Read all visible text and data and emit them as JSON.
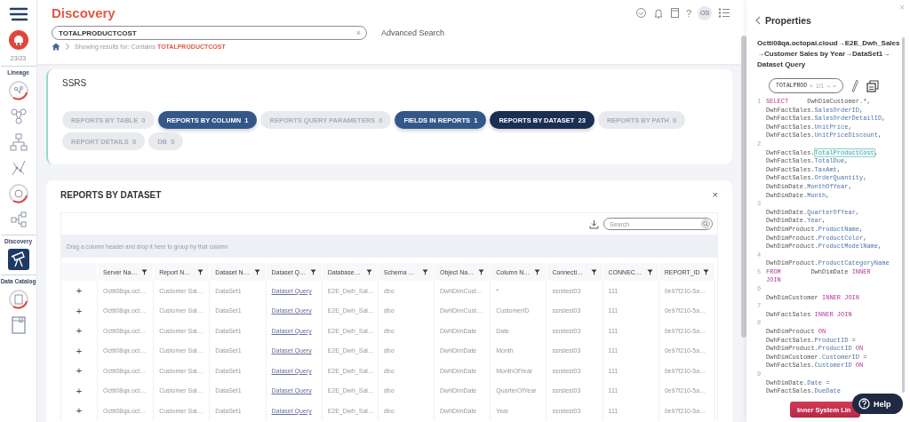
{
  "sidebar": {
    "items": [
      {
        "kind": "icon",
        "selected": false
      },
      {
        "kind": "icon",
        "selected": false
      },
      {
        "kind": "counter",
        "text": "23/23"
      },
      {
        "kind": "label",
        "text": "Lineage"
      },
      {
        "kind": "icon",
        "selected": false
      },
      {
        "kind": "icon",
        "selected": false
      },
      {
        "kind": "icon",
        "selected": false
      },
      {
        "kind": "icon",
        "selected": false
      },
      {
        "kind": "icon",
        "selected": false
      },
      {
        "kind": "icon",
        "selected": false
      },
      {
        "kind": "label",
        "text": "Discovery"
      },
      {
        "kind": "icon",
        "selected": true
      },
      {
        "kind": "label",
        "text": "Data Catalog"
      },
      {
        "kind": "icon",
        "selected": false
      },
      {
        "kind": "icon",
        "selected": false
      }
    ]
  },
  "header": {
    "title": "Discovery",
    "help": "?",
    "avatar": "OS",
    "search": {
      "value": "TOTALPRODUCTCOST",
      "clear": "×"
    },
    "advanced_search": "Advanced Search",
    "breadcrumb": "Showing results for: Contains **TOTALPRODUCTCOST**"
  },
  "ssrs": {
    "title": "SSRS",
    "tabs": [
      {
        "label": "REPORTS BY TABLE  0",
        "selected": false,
        "disabled": true
      },
      {
        "label": "REPORTS BY COLUMN  1",
        "selected": false,
        "disabled": false
      },
      {
        "label": "REPORTS QUERY PARAMETERS  0",
        "selected": false,
        "disabled": true
      },
      {
        "label": "FIELDS IN REPORTS  1",
        "selected": false,
        "disabled": false
      },
      {
        "label": "REPORTS BY DATASET  23",
        "selected": true,
        "disabled": false
      },
      {
        "label": "REPORTS BY PATH  0",
        "selected": false,
        "disabled": true
      },
      {
        "label": "REPORT DETAILS  0",
        "selected": false,
        "disabled": true
      },
      {
        "label": "DB  0",
        "selected": false,
        "disabled": true
      }
    ]
  },
  "reports": {
    "title": "REPORTS BY DATASET",
    "close": "×",
    "search": {
      "placeholder": "Search"
    },
    "group_hint": "Drag a column header and drop it here to group by that column",
    "columns": [
      {
        "label": "Server Na…",
        "kind": "text"
      },
      {
        "label": "Report N…",
        "kind": "text"
      },
      {
        "label": "Dataset N…",
        "kind": "text"
      },
      {
        "label": "Dataset Q…",
        "kind": "link"
      },
      {
        "label": "Database…",
        "kind": "text"
      },
      {
        "label": "Schema …",
        "kind": "text"
      },
      {
        "label": "Object Na…",
        "kind": "text"
      },
      {
        "label": "Column N…",
        "kind": "text"
      },
      {
        "label": "Connecti…",
        "kind": "text"
      },
      {
        "label": "CONNEC…",
        "kind": "text"
      },
      {
        "label": "REPORT_ID",
        "kind": "text"
      }
    ],
    "rows": [
      {
        "expand": "+",
        "cells": [
          "Octti08qa.oct…",
          "Customer Sal…",
          "DataSet1",
          "Dataset Query",
          "E2E_Dwh_Sal…",
          "dbo",
          "DwhDimCust…",
          "*",
          "ssrstest03",
          "111",
          "0e97f210-5a…"
        ]
      },
      {
        "expand": "+",
        "cells": [
          "Octti08qa.oct…",
          "Customer Sal…",
          "DataSet1",
          "Dataset Query",
          "E2E_Dwh_Sal…",
          "dbo",
          "DwhDimCust…",
          "CustomerID",
          "ssrstest03",
          "111",
          "0e97f210-5a…"
        ]
      },
      {
        "expand": "+",
        "cells": [
          "Octti08qa.oct…",
          "Customer Sal…",
          "DataSet1",
          "Dataset Query",
          "E2E_Dwh_Sal…",
          "dbo",
          "DwhDimDate",
          "Date",
          "ssrstest03",
          "111",
          "0e97f210-5a…"
        ]
      },
      {
        "expand": "+",
        "cells": [
          "Octti08qa.oct…",
          "Customer Sal…",
          "DataSet1",
          "Dataset Query",
          "E2E_Dwh_Sal…",
          "dbo",
          "DwhDimDate",
          "Month",
          "ssrstest03",
          "111",
          "0e97f210-5a…"
        ]
      },
      {
        "expand": "+",
        "cells": [
          "Octti08qa.oct…",
          "Customer Sal…",
          "DataSet1",
          "Dataset Query",
          "E2E_Dwh_Sal…",
          "dbo",
          "DwhDimDate",
          "MonthOfYear",
          "ssrstest03",
          "111",
          "0e97f210-5a…"
        ]
      },
      {
        "expand": "+",
        "cells": [
          "Octti08qa.oct…",
          "Customer Sal…",
          "DataSet1",
          "Dataset Query",
          "E2E_Dwh_Sal…",
          "dbo",
          "DwhDimDate",
          "QuarterOfYear",
          "ssrstest03",
          "111",
          "0e97f210-5a…"
        ]
      },
      {
        "expand": "+",
        "cells": [
          "Octti08qa.oct…",
          "Customer Sal…",
          "DataSet1",
          "Dataset Query",
          "E2E_Dwh_Sal…",
          "dbo",
          "DwhDimDate",
          "Year",
          "ssrstest03",
          "111",
          "0e97f210-5a…"
        ]
      }
    ]
  },
  "properties": {
    "title": "Properties",
    "close": "×",
    "path": "Octti08qa.octopai.cloud→E2E_Dwh_Sales →Customer Sales by Year→DataSet1→ Dataset Query",
    "find": {
      "value": "TOTALPROD",
      "clear": "×",
      "count": "1/1"
    },
    "code": [
      {
        "number": "1",
        "leading_blank": false,
        "lines": [
          {
            "segments": [
              {
                "text": "SELECT",
                "kind": "keyword"
              },
              {
                "text": "     DwhDimCustomer.*,",
                "kind": "plain"
              }
            ]
          },
          {
            "segments": [
              {
                "text": "DwhFactSales.",
                "kind": "plain"
              },
              {
                "text": "SalesOrderID",
                "kind": "field"
              },
              {
                "text": ",",
                "kind": "plain"
              }
            ]
          },
          {
            "segments": [
              {
                "text": "DwhFactSales.",
                "kind": "plain"
              },
              {
                "text": "SalesOrderDetailID",
                "kind": "field"
              },
              {
                "text": ",",
                "kind": "plain"
              }
            ]
          },
          {
            "segments": [
              {
                "text": "DwhFactSales.",
                "kind": "plain"
              },
              {
                "text": "UnitPrice",
                "kind": "field"
              },
              {
                "text": ",",
                "kind": "plain"
              }
            ]
          },
          {
            "segments": [
              {
                "text": "DwhFactSales.",
                "kind": "plain"
              },
              {
                "text": "UnitPriceDiscount",
                "kind": "field"
              },
              {
                "text": ",",
                "kind": "plain"
              }
            ]
          }
        ]
      },
      {
        "number": "2",
        "leading_blank": true,
        "lines": [
          {
            "segments": [
              {
                "text": "DwhFactSales.",
                "kind": "plain"
              },
              {
                "text": "TotalProductCost",
                "kind": "match"
              },
              {
                "text": ",",
                "kind": "plain"
              }
            ]
          },
          {
            "segments": [
              {
                "text": "DwhFactSales.",
                "kind": "plain"
              },
              {
                "text": "TotalDue",
                "kind": "field"
              },
              {
                "text": ",",
                "kind": "plain"
              }
            ]
          },
          {
            "segments": [
              {
                "text": "DwhFactSales.",
                "kind": "plain"
              },
              {
                "text": "TaxAmt",
                "kind": "field"
              },
              {
                "text": ",",
                "kind": "plain"
              }
            ]
          },
          {
            "segments": [
              {
                "text": "DwhFactSales.",
                "kind": "plain"
              },
              {
                "text": "OrderQuantity",
                "kind": "field"
              },
              {
                "text": ",",
                "kind": "plain"
              }
            ]
          },
          {
            "segments": [
              {
                "text": "DwhDimDate.",
                "kind": "plain"
              },
              {
                "text": "MonthOfYear",
                "kind": "field"
              },
              {
                "text": ",",
                "kind": "plain"
              }
            ]
          },
          {
            "segments": [
              {
                "text": "DwhDimDate.",
                "kind": "plain"
              },
              {
                "text": "Month",
                "kind": "field"
              },
              {
                "text": ",",
                "kind": "plain"
              }
            ]
          }
        ]
      },
      {
        "number": "3",
        "leading_blank": true,
        "lines": [
          {
            "segments": [
              {
                "text": "DwhDimDate.",
                "kind": "plain"
              },
              {
                "text": "QuarterOfYear",
                "kind": "field"
              },
              {
                "text": ",",
                "kind": "plain"
              }
            ]
          },
          {
            "segments": [
              {
                "text": "DwhDimDate.",
                "kind": "plain"
              },
              {
                "text": "Year",
                "kind": "field"
              },
              {
                "text": ",",
                "kind": "plain"
              }
            ]
          },
          {
            "segments": [
              {
                "text": "DwhDimProduct.",
                "kind": "plain"
              },
              {
                "text": "ProductName",
                "kind": "field"
              },
              {
                "text": ",",
                "kind": "plain"
              }
            ]
          },
          {
            "segments": [
              {
                "text": "DwhDimProduct.",
                "kind": "plain"
              },
              {
                "text": "ProductColor",
                "kind": "field"
              },
              {
                "text": ",",
                "kind": "plain"
              }
            ]
          },
          {
            "segments": [
              {
                "text": "DwhDimProduct.",
                "kind": "plain"
              },
              {
                "text": "ProductModelName",
                "kind": "field"
              },
              {
                "text": ",",
                "kind": "plain"
              }
            ]
          }
        ]
      },
      {
        "number": "4",
        "leading_blank": true,
        "lines": [
          {
            "segments": [
              {
                "text": "DwhDimProduct.",
                "kind": "plain"
              },
              {
                "text": "ProductCategoryName",
                "kind": "field"
              }
            ]
          }
        ]
      },
      {
        "number": "5",
        "leading_blank": false,
        "lines": [
          {
            "segments": [
              {
                "text": "FROM",
                "kind": "keyword"
              },
              {
                "text": "        DwhDimDate ",
                "kind": "plain"
              },
              {
                "text": "INNER",
                "kind": "keyword"
              }
            ]
          },
          {
            "segments": [
              {
                "text": "JOIN",
                "kind": "keyword"
              }
            ]
          }
        ]
      },
      {
        "number": "6",
        "leading_blank": true,
        "lines": [
          {
            "segments": [
              {
                "text": "DwhDimCustomer ",
                "kind": "plain"
              },
              {
                "text": "INNER JOIN",
                "kind": "keyword"
              }
            ]
          }
        ]
      },
      {
        "number": "7",
        "leading_blank": true,
        "lines": [
          {
            "segments": [
              {
                "text": "DwhFactSales ",
                "kind": "plain"
              },
              {
                "text": "INNER JOIN",
                "kind": "keyword"
              }
            ]
          }
        ]
      },
      {
        "number": "8",
        "leading_blank": true,
        "lines": [
          {
            "segments": [
              {
                "text": "DwhDimProduct ",
                "kind": "plain"
              },
              {
                "text": "ON",
                "kind": "keyword"
              }
            ]
          },
          {
            "segments": [
              {
                "text": "DwhFactSales.",
                "kind": "plain"
              },
              {
                "text": "ProductID",
                "kind": "field"
              },
              {
                "text": " =",
                "kind": "plain"
              }
            ]
          },
          {
            "segments": [
              {
                "text": "DwhDimProduct.",
                "kind": "plain"
              },
              {
                "text": "ProductID",
                "kind": "field"
              },
              {
                "text": " ON",
                "kind": "keyword"
              }
            ]
          },
          {
            "segments": [
              {
                "text": "DwhDimCustomer.",
                "kind": "plain"
              },
              {
                "text": "CustomerID",
                "kind": "field"
              },
              {
                "text": " =",
                "kind": "plain"
              }
            ]
          },
          {
            "segments": [
              {
                "text": "DwhFactSales.",
                "kind": "plain"
              },
              {
                "text": "CustomerID",
                "kind": "field"
              },
              {
                "text": " ON",
                "kind": "keyword"
              }
            ]
          }
        ]
      },
      {
        "number": "9",
        "leading_blank": true,
        "lines": [
          {
            "segments": [
              {
                "text": "DwhDimDate.",
                "kind": "plain"
              },
              {
                "text": "Date",
                "kind": "field"
              },
              {
                "text": " =",
                "kind": "plain"
              }
            ]
          },
          {
            "segments": [
              {
                "text": "DwhFactSales.",
                "kind": "plain"
              },
              {
                "text": "DueDate",
                "kind": "field"
              }
            ]
          }
        ]
      }
    ],
    "action_button": "Inner System Lin",
    "help_button": "Help"
  }
}
